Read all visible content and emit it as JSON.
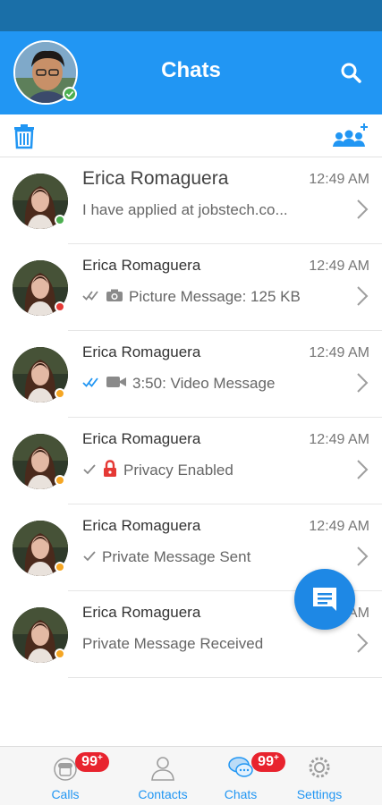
{
  "header": {
    "title": "Chats",
    "status_color": "#4caf50"
  },
  "colors": {
    "accent": "#2196f3",
    "status_bar": "#1a6fa8",
    "badge": "#e8232e",
    "lock": "#e53935",
    "online": "#4caf50",
    "away": "#f5a623",
    "busy": "#e53935",
    "read_tick": "#2196f3"
  },
  "chats": [
    {
      "name": "Erica Romaguera",
      "time": "12:49 AM",
      "preview": "I have applied at jobstech.co...",
      "status": "online",
      "icon": "none",
      "tick": "none"
    },
    {
      "name": "Erica Romaguera",
      "time": "12:49 AM",
      "preview": "Picture Message: 125 KB",
      "status": "busy",
      "icon": "camera-icon",
      "tick": "double-grey"
    },
    {
      "name": "Erica Romaguera",
      "time": "12:49 AM",
      "preview": "3:50: Video Message",
      "status": "away",
      "icon": "video-icon",
      "tick": "double-blue"
    },
    {
      "name": "Erica Romaguera",
      "time": "12:49 AM",
      "preview": "Privacy Enabled",
      "status": "away",
      "icon": "lock-icon",
      "tick": "single-grey"
    },
    {
      "name": "Erica Romaguera",
      "time": "12:49 AM",
      "preview": "Private Message Sent",
      "status": "away",
      "icon": "none",
      "tick": "single-grey"
    },
    {
      "name": "Erica Romaguera",
      "time": "AM",
      "preview": "Private Message Received",
      "status": "away",
      "icon": "none",
      "tick": "none"
    }
  ],
  "tabs": [
    {
      "label": "Calls",
      "icon": "phone-icon",
      "badge": "99",
      "badge_plus": "+"
    },
    {
      "label": "Contacts",
      "icon": "contact-icon",
      "badge": "",
      "badge_plus": ""
    },
    {
      "label": "Chats",
      "icon": "chat-bubbles-icon",
      "badge": "99",
      "badge_plus": "+"
    },
    {
      "label": "Settings",
      "icon": "gear-icon",
      "badge": "",
      "badge_plus": ""
    }
  ]
}
